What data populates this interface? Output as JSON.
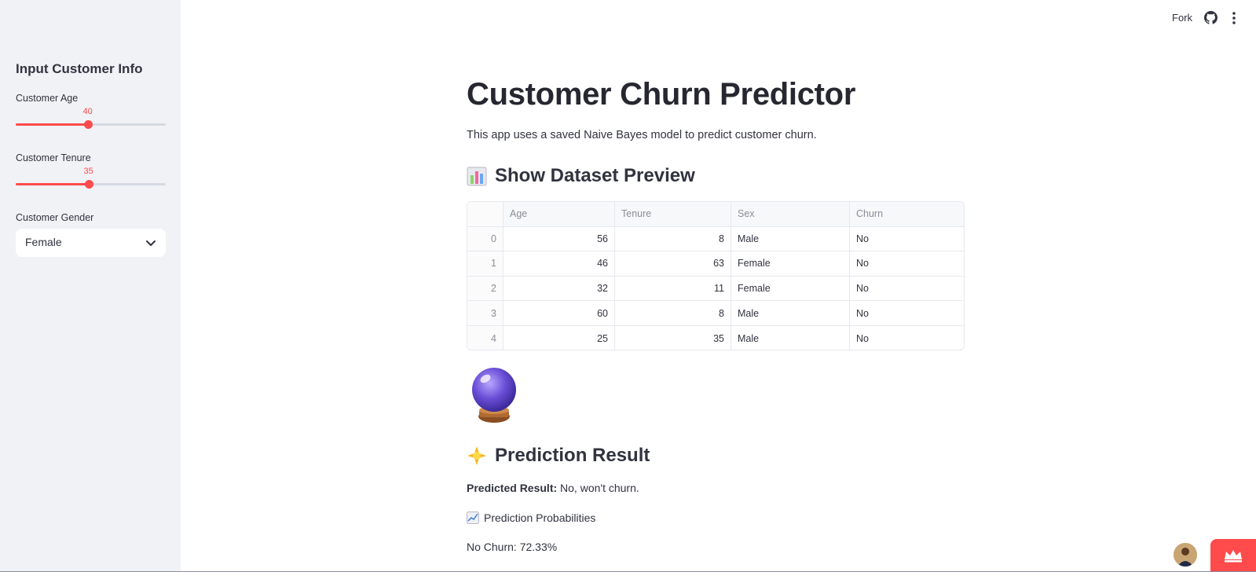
{
  "sidebar": {
    "title": "Input Customer Info",
    "age": {
      "label": "Customer Age",
      "value": "40",
      "fraction": 0.48
    },
    "tenure": {
      "label": "Customer Tenure",
      "value": "35",
      "fraction": 0.485
    },
    "gender": {
      "label": "Customer Gender",
      "selected": "Female"
    }
  },
  "toolbar": {
    "fork_label": "Fork",
    "github_icon": "github-icon",
    "menu_icon": "kebab-menu-icon"
  },
  "main": {
    "title": "Customer Churn Predictor",
    "intro": "This app uses a saved Naive Bayes model to predict customer churn.",
    "dataset_heading": "Show Dataset Preview",
    "dataset_icon": "bar-chart-icon",
    "table": {
      "columns": [
        "",
        "Age",
        "Tenure",
        "Sex",
        "Churn"
      ],
      "rows": [
        [
          "0",
          "56",
          "8",
          "Male",
          "No"
        ],
        [
          "1",
          "46",
          "63",
          "Female",
          "No"
        ],
        [
          "2",
          "32",
          "11",
          "Female",
          "No"
        ],
        [
          "3",
          "60",
          "8",
          "Male",
          "No"
        ],
        [
          "4",
          "25",
          "35",
          "Male",
          "No"
        ]
      ]
    },
    "crystal_ball_icon": "crystal-ball-icon",
    "prediction_heading": "Prediction Result",
    "prediction_icon": "sparkle-icon",
    "predicted_label": "Predicted Result:",
    "predicted_value": "No, won't churn.",
    "probabilities_label": "Prediction Probabilities",
    "probabilities_icon": "line-chart-icon",
    "no_churn": "No Churn: 72.33%"
  },
  "colors": {
    "accent": "#ff4b4b",
    "sidebar_bg": "#f0f2f6",
    "text": "#31333f"
  }
}
